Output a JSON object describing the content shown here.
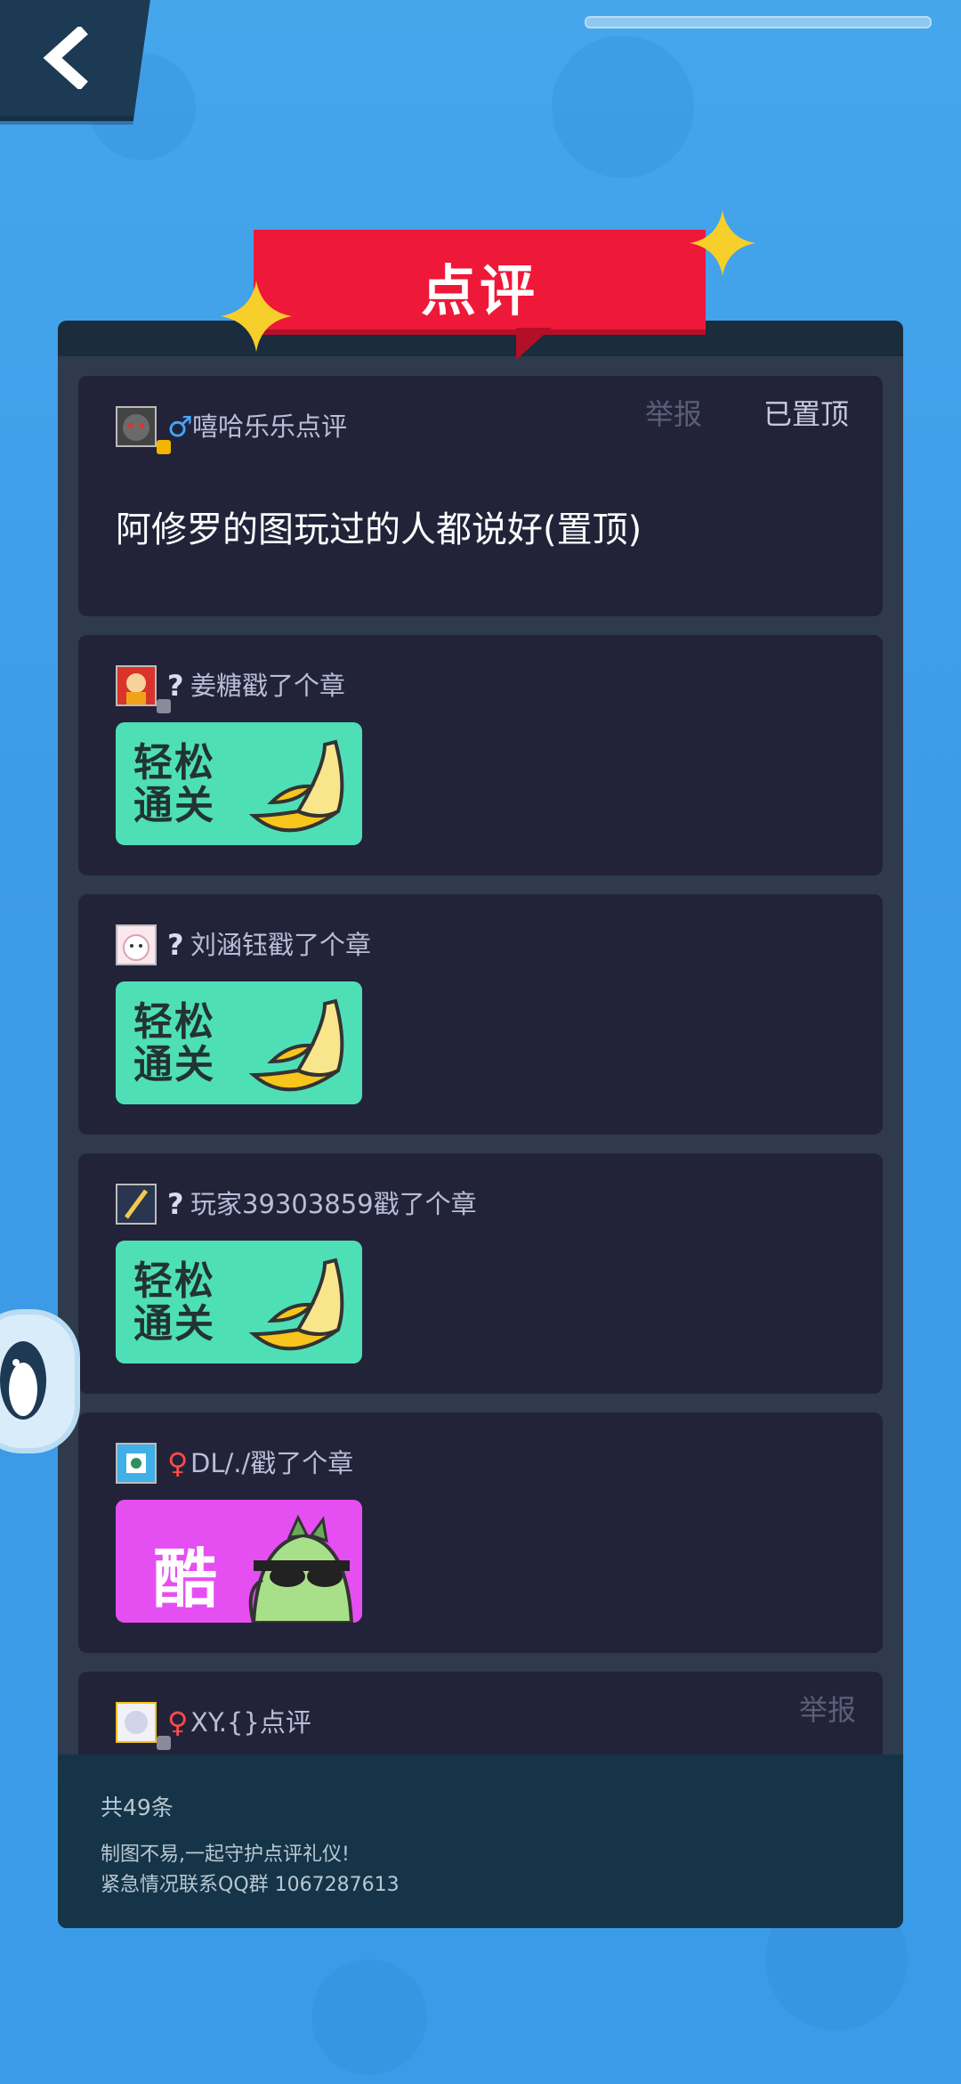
{
  "header": {
    "back_icon": "chevron-left-icon",
    "title": "点评"
  },
  "comments": [
    {
      "user": "嘻哈乐乐点评",
      "gender": "♂",
      "report": "举报",
      "pinned": "已置顶",
      "text": "阿修罗的图玩过的人都说好(置顶)"
    },
    {
      "user": "姜糖戳了个章",
      "gender": "?",
      "sticker": "轻松通关"
    },
    {
      "user": "刘涵钰戳了个章",
      "gender": "?",
      "sticker": "轻松通关"
    },
    {
      "user": "玩家39303859戳了个章",
      "gender": "?",
      "sticker": "轻松通关"
    },
    {
      "user": "DL/./戳了个章",
      "gender": "♀",
      "sticker": "酷"
    },
    {
      "user": "XY.{}点评",
      "gender": "♀",
      "report": "举报"
    }
  ],
  "footer": {
    "total": "共49条",
    "note1": "制图不易,一起守护点评礼仪!",
    "note2": "紧急情况联系QQ群 1067287613"
  },
  "colors": {
    "banner": "#ee1838",
    "card": "#222339",
    "male": "#45a6ff",
    "female": "#ff4a4a",
    "sticker_green": "#4fdfb6",
    "sticker_pink": "#e54ff2"
  }
}
